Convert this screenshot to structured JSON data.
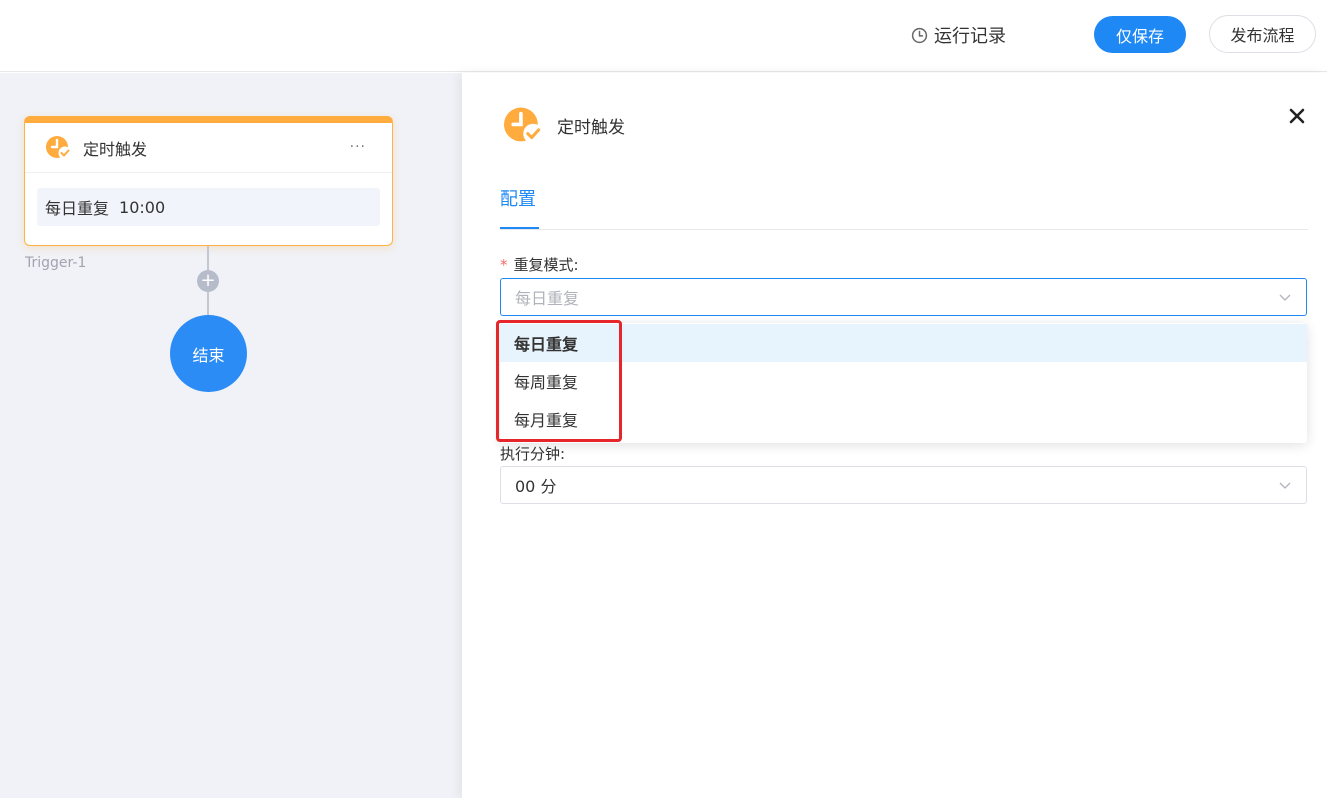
{
  "header": {
    "run_record_label": "运行记录",
    "save_label": "仅保存",
    "publish_label": "发布流程"
  },
  "canvas": {
    "trigger_node": {
      "title": "定时触发",
      "more": "···",
      "summary_mode": "每日重复",
      "summary_time": "10:00",
      "label": "Trigger-1"
    },
    "add_symbol": "+",
    "end_node_label": "结束"
  },
  "panel": {
    "title": "定时触发",
    "tab_label": "配置",
    "repeat_mode": {
      "required_mark": "*",
      "label": "重复模式:",
      "placeholder": "每日重复",
      "options": [
        "每日重复",
        "每周重复",
        "每月重复"
      ],
      "selected_index": 0
    },
    "minute": {
      "label": "执行分钟:",
      "value": "00 分"
    }
  },
  "colors": {
    "primary": "#1e88f5",
    "trigger_orange": "#ffab3e",
    "highlight_red": "#e5262a"
  },
  "icons": {
    "run_record": "clock-icon",
    "trigger": "clock-check-icon",
    "close": "close-icon",
    "chevron": "chevron-down-icon"
  }
}
